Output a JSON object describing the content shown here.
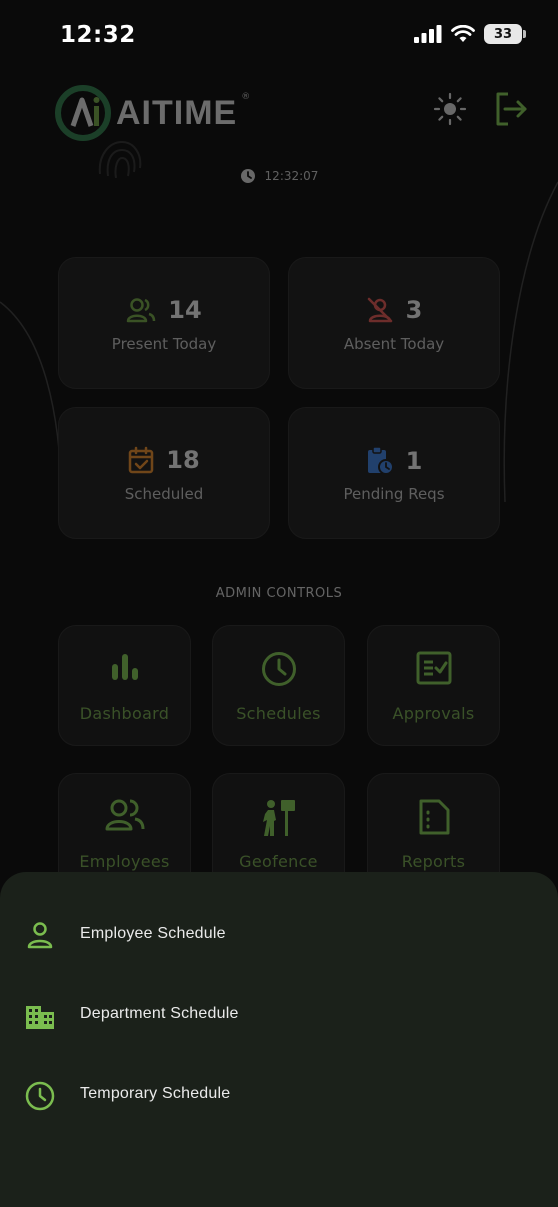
{
  "status_bar": {
    "time": "12:32",
    "battery": "33"
  },
  "header": {
    "brand": "AITIME",
    "brand_mark": "®",
    "clock": "12:32:07"
  },
  "stats": [
    {
      "value": "14",
      "label": "Present Today",
      "icon": "people-icon",
      "color": "#6ea044"
    },
    {
      "value": "3",
      "label": "Absent Today",
      "icon": "person-off-icon",
      "color": "#d9534f"
    },
    {
      "value": "18",
      "label": "Scheduled",
      "icon": "calendar-check-icon",
      "color": "#e0882a"
    },
    {
      "value": "1",
      "label": "Pending Reqs",
      "icon": "clipboard-clock-icon",
      "color": "#3b7bd8"
    }
  ],
  "admin": {
    "title": "ADMIN CONTROLS",
    "tiles": [
      {
        "label": "Dashboard",
        "icon": "bar-chart-icon"
      },
      {
        "label": "Schedules",
        "icon": "clock-icon"
      },
      {
        "label": "Approvals",
        "icon": "checklist-icon"
      },
      {
        "label": "Employees",
        "icon": "people-icon"
      },
      {
        "label": "Geofence",
        "icon": "person-sign-icon"
      },
      {
        "label": "Reports",
        "icon": "document-icon"
      }
    ]
  },
  "sheet": {
    "items": [
      {
        "label": "Employee Schedule",
        "icon": "person-icon"
      },
      {
        "label": "Department Schedule",
        "icon": "building-icon"
      },
      {
        "label": "Temporary Schedule",
        "icon": "clock-icon"
      }
    ]
  },
  "colors": {
    "accent": "#7bbd4f",
    "sheet_bg": "#1b211a",
    "background": "#0a0a0a"
  }
}
